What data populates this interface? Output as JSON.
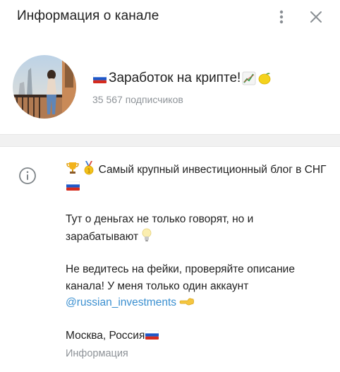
{
  "header": {
    "title": "Информация о канале",
    "more_icon": "more-vertical-icon",
    "close_icon": "close-icon"
  },
  "channel": {
    "name": "Заработок на крипте!",
    "subscribers": "35 567 подписчиков",
    "avatar_icon": "channel-avatar-photo"
  },
  "about": {
    "line1": "Самый крупный инвестиционный блог в СНГ",
    "line2": "Тут о деньгах не только говорят, но и зарабатывают",
    "line3": "Не ведитесь на фейки, проверяйте описание канала! У меня только один аккаунт",
    "link": "@russian_investments",
    "location": "Москва, Россия",
    "caption": "Информация",
    "info_icon": "info-icon"
  },
  "colors": {
    "link": "#3a8fd0",
    "secondary_text": "#8e9398",
    "divider": "#f1f1f1"
  }
}
